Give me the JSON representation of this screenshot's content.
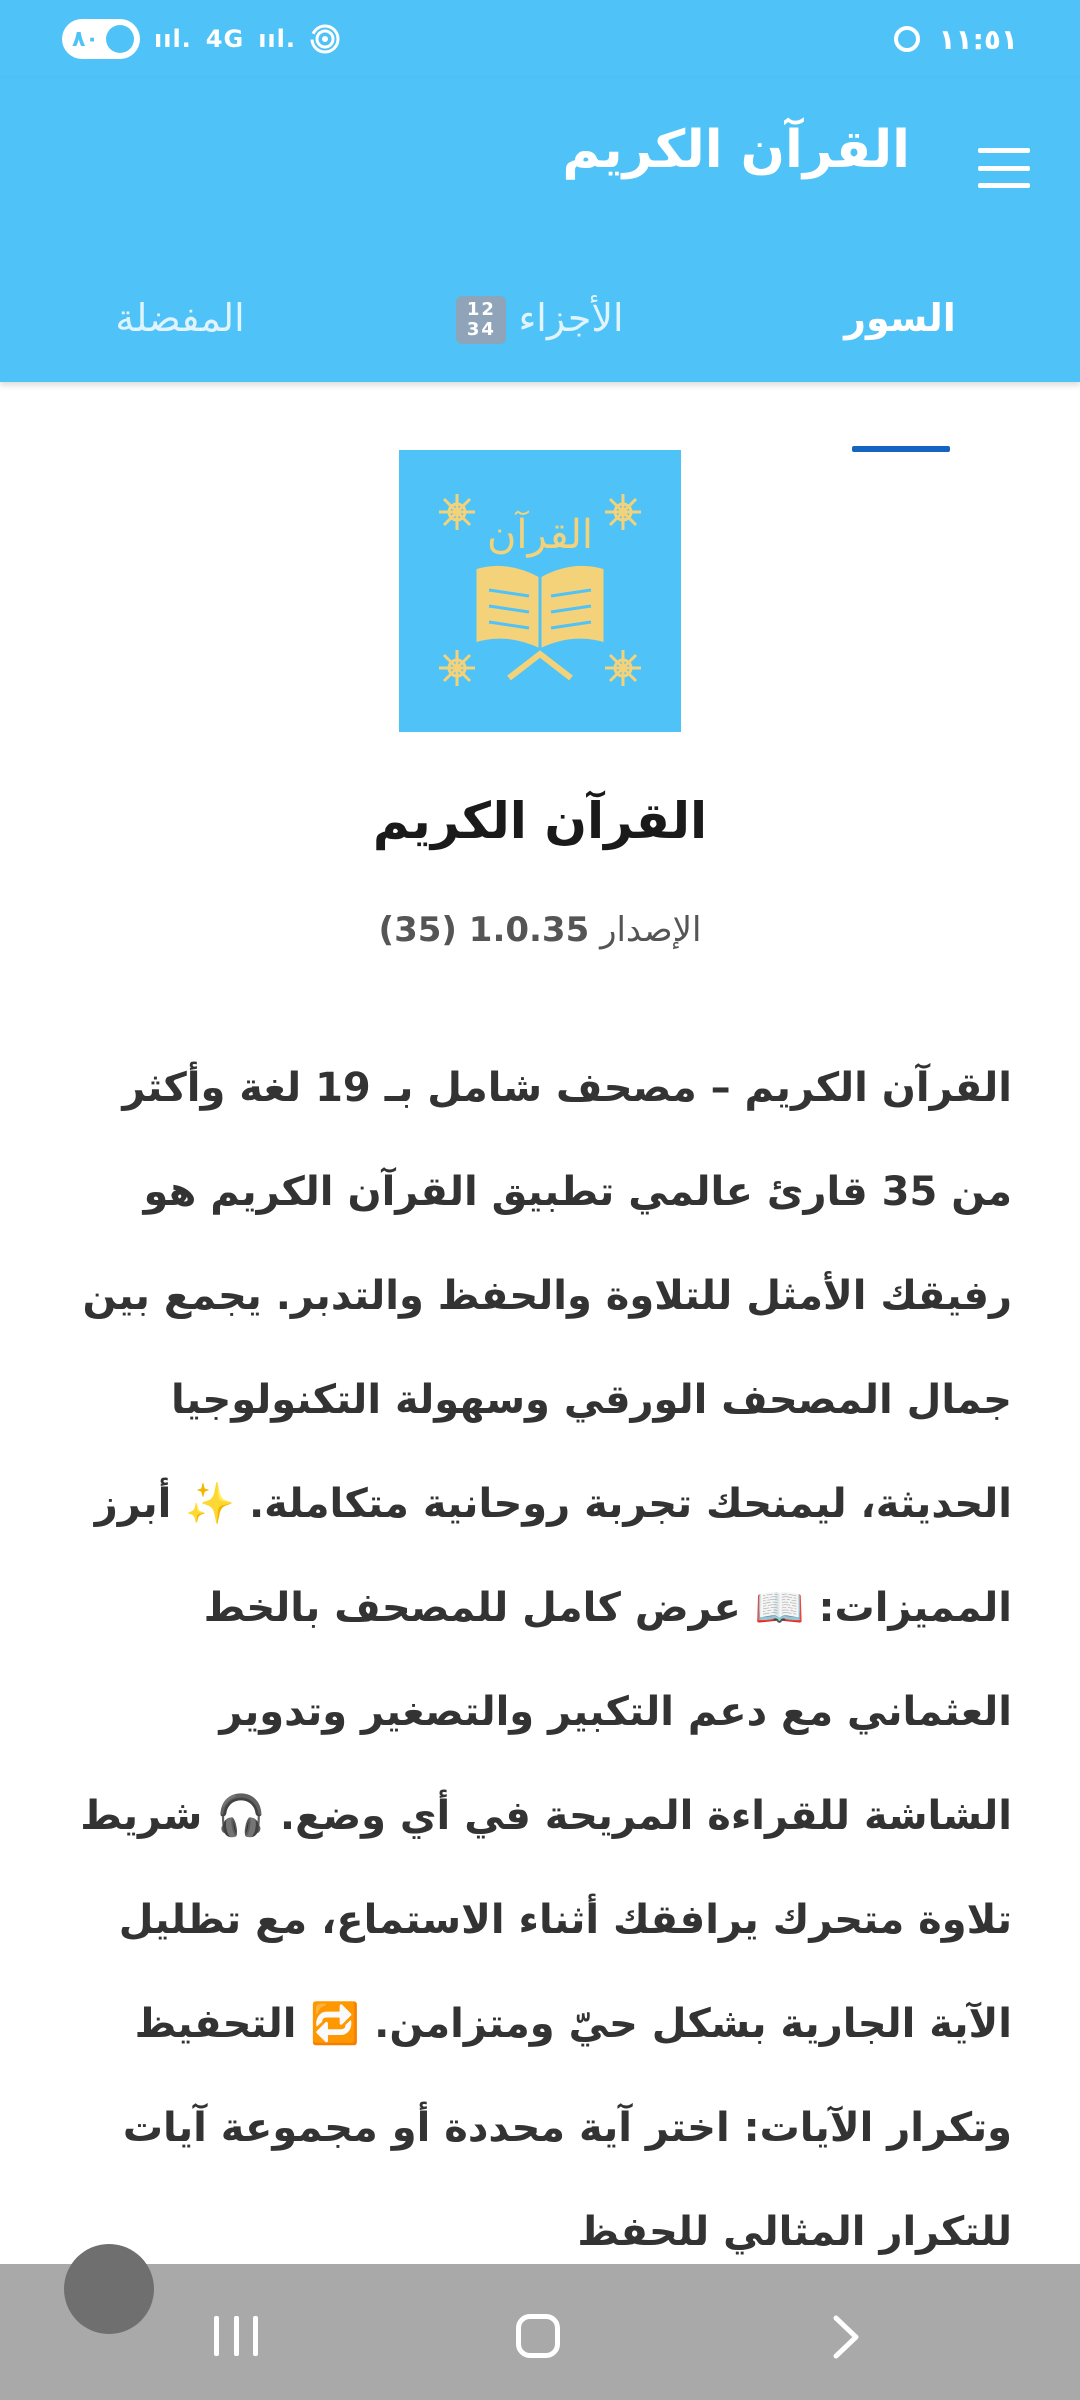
{
  "status_bar": {
    "time": "١١:٥١",
    "battery": "٨٠",
    "network_label": "4G"
  },
  "app_bar": {
    "title": "القرآن الكريم"
  },
  "tabs": [
    {
      "label": "السور",
      "active": true
    },
    {
      "label": "الأجزاء",
      "badge": "1234",
      "active": false
    },
    {
      "label": "المفضلة",
      "active": false
    }
  ],
  "about": {
    "logo_text": "القرآن",
    "app_name": "القرآن الكريم",
    "version_label": "الإصدار",
    "version_value": "1.0.35 (35)",
    "description": "القرآن الكريم – مصحف شامل بـ 19 لغة وأكثر من 35 قارئ عالمي تطبيق القرآن الكريم هو رفيقك الأمثل للتلاوة والحفظ والتدبر. يجمع بين جمال المصحف الورقي وسهولة التكنولوجيا الحديثة، ليمنحك تجربة روحانية متكاملة. ✨ أبرز المميزات: 📖 عرض كامل للمصحف بالخط العثماني مع دعم التكبير والتصغير وتدوير الشاشة للقراءة المريحة في أي وضع. 🎧 شريط تلاوة متحرك يرافقك أثناء الاستماع، مع تظليل الآية الجارية بشكل حيّ ومتزامن. 🔁 التحفيظ وتكرار الآيات: اختر آية محددة أو مجموعة آيات للتكرار المثالي للحفظ"
  },
  "colors": {
    "primary": "#4fc3f7",
    "tab_indicator": "#1565c0",
    "logo_gold": "#f3d27a",
    "nav_bar": "#a9a9a9"
  },
  "icons": {
    "menu": "hamburger-menu-icon",
    "alarm": "alarm-icon",
    "battery": "battery-icon",
    "nav_recents": "recents-icon",
    "nav_home": "home-icon",
    "nav_back": "back-icon"
  }
}
